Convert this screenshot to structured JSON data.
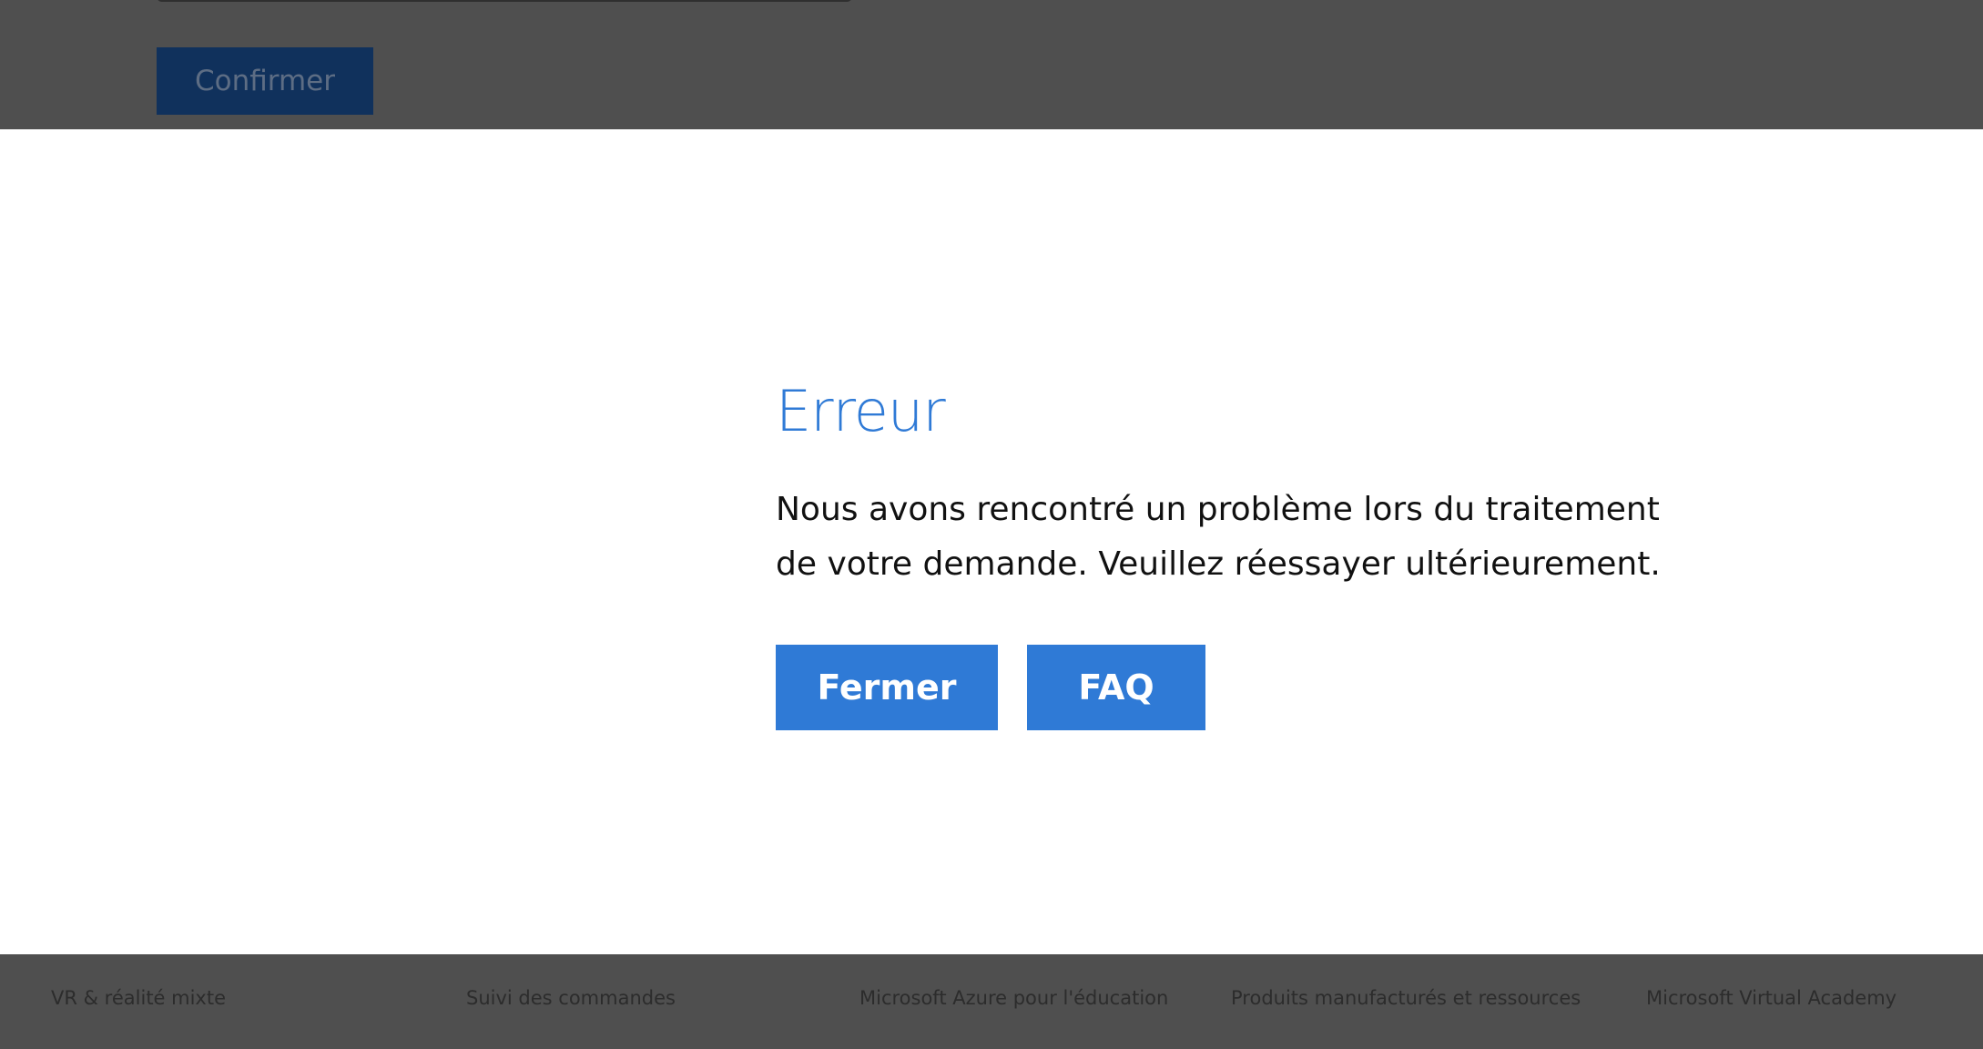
{
  "background": {
    "confirm_label": "Confirmer"
  },
  "modal": {
    "title": "Erreur",
    "message": "Nous avons rencontré un problème lors du traitement de votre demande. Veuillez réessayer ultérieurement.",
    "close_label": "Fermer",
    "faq_label": "FAQ"
  },
  "footer": {
    "links": [
      "VR & réalité mixte",
      "Suivi des commandes",
      "Microsoft Azure pour l'éducation",
      "Produits manufacturés et ressources",
      "Microsoft Virtual Academy"
    ]
  },
  "colors": {
    "accent": "#2f7ad6",
    "overlay": "#4f4f4f",
    "dim_button": "#10315c"
  }
}
